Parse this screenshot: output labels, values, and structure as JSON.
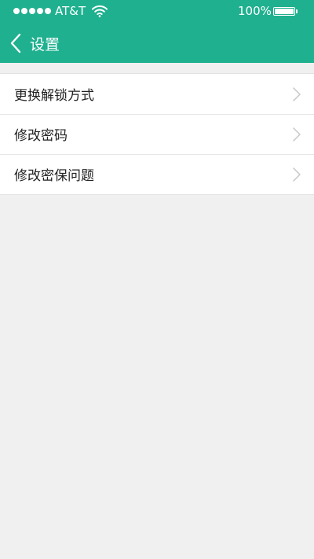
{
  "status_bar": {
    "carrier": "AT&T",
    "battery": "100%",
    "signal_bars": 5
  },
  "nav": {
    "title": "设置",
    "back_icon": "chevron-left-icon"
  },
  "menu": {
    "items": [
      {
        "label": "更换解锁方式"
      },
      {
        "label": "修改密码"
      },
      {
        "label": "修改密保问题"
      }
    ]
  },
  "colors": {
    "header": "#1fb08f",
    "background": "#f0f0f0",
    "row": "#ffffff",
    "chevron": "#c7c7cc"
  }
}
